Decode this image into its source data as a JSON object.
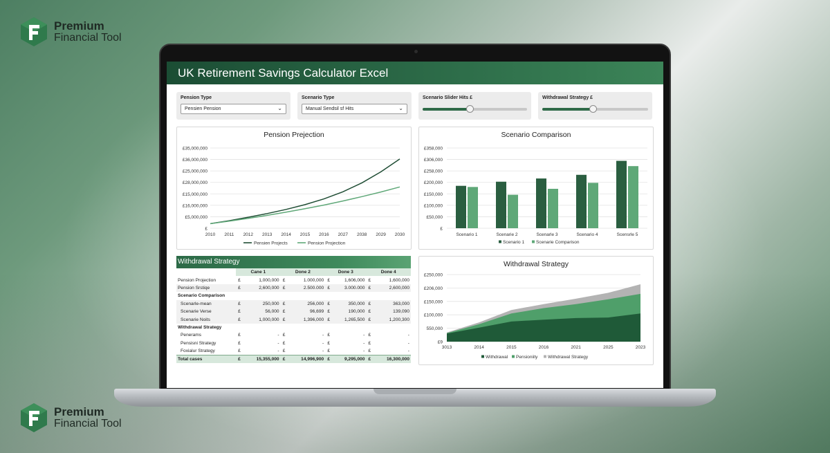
{
  "brand": {
    "line1": "Premium",
    "line2": "Financial Tool"
  },
  "app": {
    "title": "UK Retirement Savings Calculator Excel"
  },
  "controls": {
    "pension_type": {
      "label": "Pension Type",
      "value": "Pensien Pension"
    },
    "scenario_type": {
      "label": "Scenario Type",
      "value": "Manual Sendsil sf Hits"
    },
    "scenario_slider": {
      "label": "Scenario Slider Hits £",
      "value": 0.47
    },
    "withdrawal_strategy": {
      "label": "Withdrawal Strategy  £",
      "value": 0.5
    }
  },
  "colors": {
    "dark_green": "#1f4d34",
    "mid_green": "#3f8a5c",
    "light_green": "#6fb585",
    "grey": "#b5b5b5"
  },
  "chart_data": [
    {
      "type": "line",
      "title": "Pension Prejection",
      "categories": [
        "2010",
        "2011",
        "2012",
        "2013",
        "2014",
        "2015",
        "2016",
        "2027",
        "2038",
        "2029",
        "2030"
      ],
      "y_ticks": [
        "£35,000,000",
        "£36,000,000",
        "£25,000,000",
        "£28,000,000",
        "£15,000,000",
        "£16,000,000",
        "£5,000,000",
        "£"
      ],
      "ylim": [
        0,
        35000000
      ],
      "series": [
        {
          "name": "Pensien Projects",
          "color": "#1f4d34",
          "values": [
            2000000,
            3300000,
            4800000,
            6400000,
            8200000,
            10300000,
            12800000,
            15900000,
            19800000,
            24600000,
            30200000
          ]
        },
        {
          "name": "Pension Projection",
          "color": "#5fa878",
          "values": [
            2000000,
            3100000,
            4300000,
            5600000,
            7000000,
            8500000,
            10100000,
            11900000,
            13800000,
            15800000,
            18000000
          ]
        }
      ]
    },
    {
      "type": "bar",
      "title": "Scenario Comparison",
      "categories": [
        "Scenario 1",
        "Scenarie 2",
        "Scenarle 3",
        "Scenario 4",
        "Scensrle 5"
      ],
      "y_ticks": [
        "£358,000",
        "£306,000",
        "£258,000",
        "£200,000",
        "£150,000",
        "£100,000",
        "£50,000",
        "£"
      ],
      "ylim": [
        0,
        350000
      ],
      "series": [
        {
          "name": "Scenario 1",
          "color": "#2a5e40",
          "values": [
            185000,
            203000,
            217000,
            233000,
            294000
          ]
        },
        {
          "name": "Scenarie Comparison",
          "color": "#5fa878",
          "values": [
            180000,
            146000,
            172000,
            198000,
            271000
          ]
        }
      ]
    },
    {
      "type": "area",
      "title": "Withdrawal Strategy",
      "categories": [
        "3013",
        "2014",
        "2015",
        "2016",
        "2021",
        "2025",
        "2023"
      ],
      "y_ticks": [
        "£250,000",
        "£206,000",
        "£150,000",
        "£100,000",
        "550,000",
        "£9"
      ],
      "ylim": [
        0,
        250000
      ],
      "series": [
        {
          "name": "Withdrawal",
          "color": "#1f5a38",
          "values": [
            30000,
            52000,
            75000,
            82000,
            88000,
            90000,
            105000
          ]
        },
        {
          "name": "Pensioniity",
          "color": "#4f9f6a",
          "values": [
            32000,
            65000,
            105000,
            125000,
            140000,
            158000,
            178000
          ]
        },
        {
          "name": "Withdrawal Strategy",
          "color": "#b3b3b3",
          "values": [
            34000,
            72000,
            118000,
            140000,
            160000,
            182000,
            214000
          ]
        }
      ]
    }
  ],
  "table": {
    "title": "Withdrawal Strategy",
    "headers": [
      "",
      "Cane 1",
      "Done 2",
      "Done 3",
      "Done 4"
    ],
    "rows": [
      {
        "label": "Pension Projection",
        "values": [
          "1,000,000",
          "1.000,000",
          "1,606,000",
          "1,600,000"
        ],
        "style": ""
      },
      {
        "label": "Pension Srstiqe",
        "values": [
          "2,600,000",
          "2.500.000",
          "3.000.000",
          "2,600,000"
        ],
        "style": "shade"
      },
      {
        "label": "Scenario Comparison",
        "values": [
          "",
          "",
          "",
          ""
        ],
        "style": "section"
      },
      {
        "label": "Scenarle-mean",
        "values": [
          "250,000",
          "256,000",
          "350,000",
          "363,000"
        ],
        "style": "shade indent"
      },
      {
        "label": "Scenarie Verse",
        "values": [
          "56,000",
          "96,699",
          "190,000",
          "139,090"
        ],
        "style": "shade indent"
      },
      {
        "label": "Scenarie Noits",
        "values": [
          "1,000,000",
          "1,396,000",
          "1,265,500",
          "1,200,300"
        ],
        "style": "shade indent"
      },
      {
        "label": "Withdrawal Strategy",
        "values": [
          "",
          "",
          "",
          ""
        ],
        "style": "section"
      },
      {
        "label": "Penerams",
        "values": [
          "-",
          "-",
          "-",
          "-"
        ],
        "style": "indent"
      },
      {
        "label": "Pensisni Strategy",
        "values": [
          "-",
          "-",
          "-",
          "-"
        ],
        "style": "indent"
      },
      {
        "label": "Foxialur Strategy",
        "values": [
          "-",
          "-",
          "-",
          "-"
        ],
        "style": "indent"
      }
    ],
    "total": {
      "label": "Total cases",
      "values": [
        "15,355,000",
        "14,996,900",
        "9,295,000",
        "16,300,000"
      ]
    },
    "currency": "£"
  }
}
